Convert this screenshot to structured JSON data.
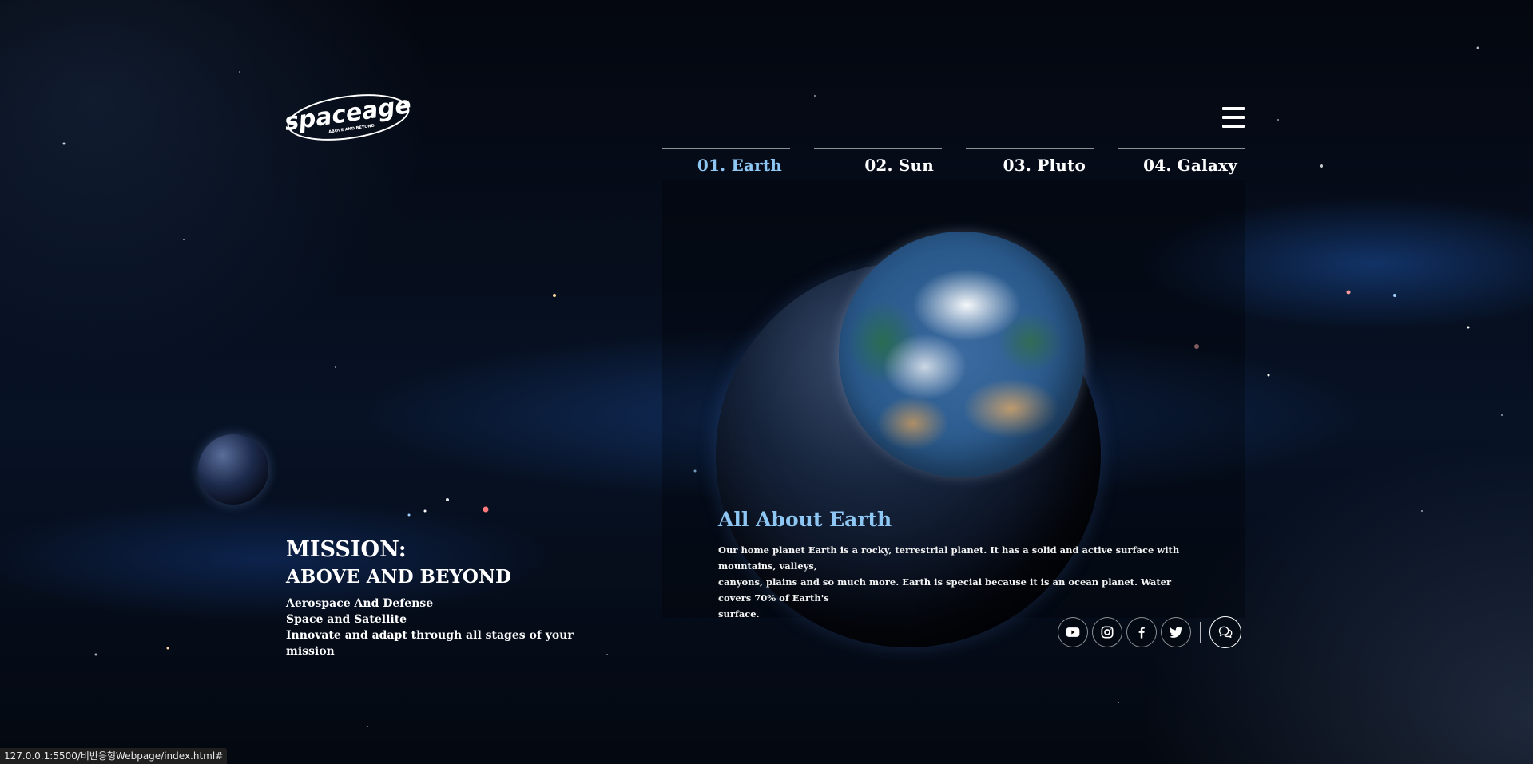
{
  "brand": {
    "logo_text": "spaceage",
    "logo_tagline": "ABOVE AND BEYOND"
  },
  "menu": {
    "icon": "hamburger-menu-icon"
  },
  "tabs": [
    {
      "label": "01. Earth",
      "active": true
    },
    {
      "label": "02. Sun",
      "active": false
    },
    {
      "label": "03. Pluto",
      "active": false
    },
    {
      "label": "04. Galaxy",
      "active": false
    }
  ],
  "info": {
    "title": "All About Earth",
    "body_line1": "Our home planet Earth is a rocky, terrestrial planet. It has a solid and active surface with mountains, valleys,",
    "body_line2": "canyons, plains and so much more. Earth is special because it is an ocean planet. Water covers 70% of Earth's",
    "body_line3": "surface."
  },
  "mission": {
    "title": "MISSION:",
    "subtitle": "ABOVE AND BEYOND",
    "lines": [
      "Aerospace And Defense",
      "Space and Satellite",
      "Innovate and adapt through all stages of your mission"
    ]
  },
  "socials": [
    {
      "icon": "youtube-icon"
    },
    {
      "icon": "instagram-icon"
    },
    {
      "icon": "facebook-icon"
    },
    {
      "icon": "twitter-icon"
    }
  ],
  "chat": {
    "icon": "chat-bubbles-icon"
  },
  "colors": {
    "accent": "#8fc7f4",
    "text": "#ffffff",
    "background": "#03060d"
  },
  "statusbar": {
    "url": "127.0.0.1:5500/비반응형Webpage/index.html#"
  }
}
